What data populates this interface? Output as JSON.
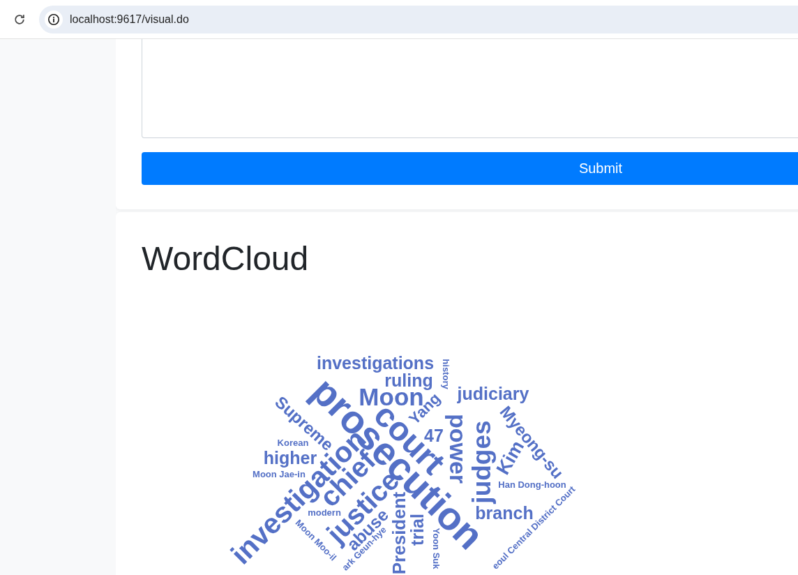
{
  "browser": {
    "url": "localhost:9617/visual.do"
  },
  "form": {
    "submit": "Submit"
  },
  "wordcloud": {
    "title": "WordCloud",
    "words": [
      {
        "text": "investigations"
      },
      {
        "text": "ruling"
      },
      {
        "text": "history"
      },
      {
        "text": "Moon"
      },
      {
        "text": "judiciary"
      },
      {
        "text": "prosecution"
      },
      {
        "text": "court"
      },
      {
        "text": "Supreme"
      },
      {
        "text": "Yang"
      },
      {
        "text": "47"
      },
      {
        "text": "power"
      },
      {
        "text": "judges"
      },
      {
        "text": "Myeong-su"
      },
      {
        "text": "Kim"
      },
      {
        "text": "Korean"
      },
      {
        "text": "higher"
      },
      {
        "text": "Moon Jae-in"
      },
      {
        "text": "investigation"
      },
      {
        "text": "chief"
      },
      {
        "text": "justice"
      },
      {
        "text": "Han Dong-hoon"
      },
      {
        "text": "branch"
      },
      {
        "text": "modern"
      },
      {
        "text": "abuse"
      },
      {
        "text": "Moon Moo-il"
      },
      {
        "text": "ark Geun-hye"
      },
      {
        "text": "President"
      },
      {
        "text": "trial"
      },
      {
        "text": "Yoon Suk"
      },
      {
        "text": "eoul Central District Court"
      }
    ]
  }
}
